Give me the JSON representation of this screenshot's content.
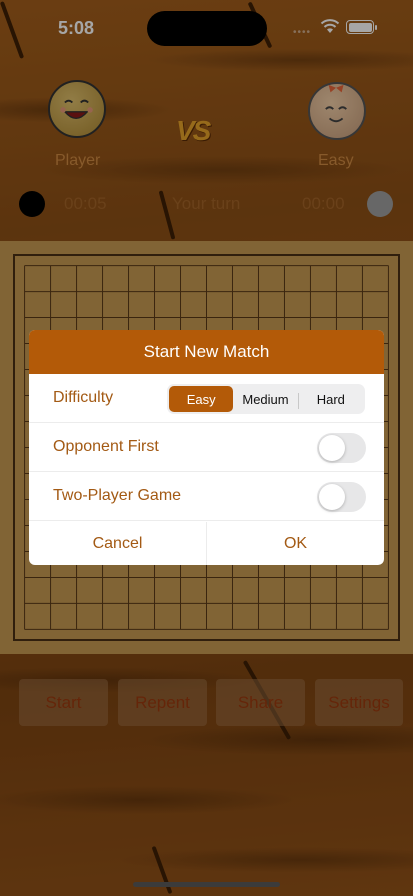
{
  "status_bar": {
    "time": "5:08"
  },
  "players": {
    "left": {
      "name": "Player",
      "timer": "00:05"
    },
    "right": {
      "name": "Easy",
      "timer": "00:00"
    },
    "vs_label": "VS",
    "turn_text": "Your turn"
  },
  "board": {
    "size": 15
  },
  "buttons": {
    "start": "Start",
    "repent": "Repent",
    "share": "Share",
    "settings": "Settings"
  },
  "dialog": {
    "title": "Start New Match",
    "difficulty_label": "Difficulty",
    "difficulty_options": [
      "Easy",
      "Medium",
      "Hard"
    ],
    "difficulty_selected": "Easy",
    "opponent_first_label": "Opponent First",
    "opponent_first_on": false,
    "two_player_label": "Two-Player Game",
    "two_player_on": false,
    "cancel_label": "Cancel",
    "ok_label": "OK"
  },
  "colors": {
    "accent": "#b35a08",
    "wood": "#8a4d14",
    "board": "#c79a52"
  }
}
